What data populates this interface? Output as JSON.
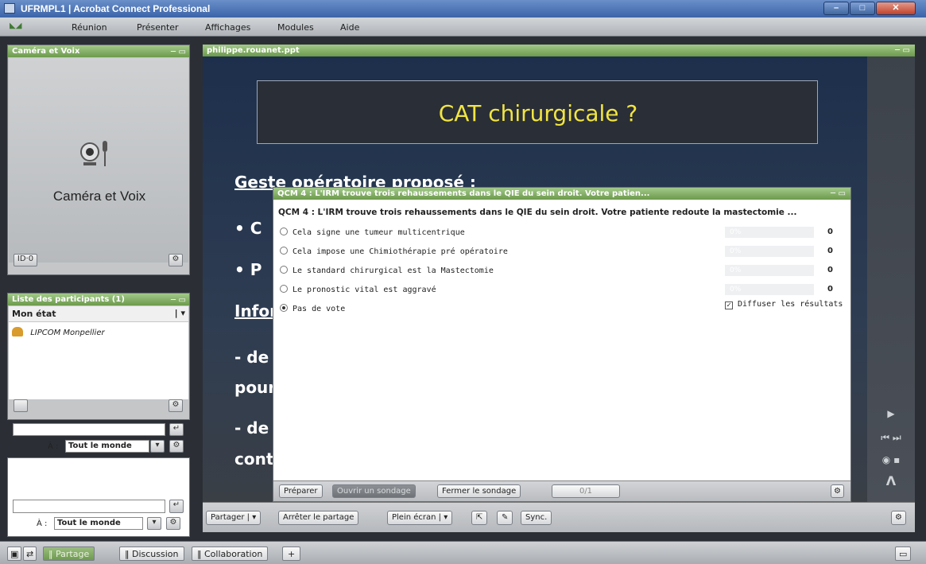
{
  "window": {
    "title": "UFRMPL1 | Acrobat Connect Professional"
  },
  "menu": {
    "items": [
      "Réunion",
      "Présenter",
      "Affichages",
      "Modules",
      "Aide"
    ]
  },
  "camera_pod": {
    "title": "Caméra et Voix",
    "label": "Caméra et Voix",
    "button_label": "ID·0"
  },
  "participants_pod": {
    "title": "Liste des participants (1)",
    "column_header": "Mon état",
    "items": [
      {
        "name": "LIPCOM Monpellier"
      }
    ]
  },
  "chat": {
    "recipient_label": "À :",
    "recipient_value": "Tout le monde"
  },
  "share_pod": {
    "title": "philippe.rouanet.ppt",
    "slide": {
      "title": "CAT chirurgicale ?",
      "lines": [
        "Geste opératoire proposé :",
        "•  C",
        "•  P",
        "Infor",
        "- de",
        "pour",
        "- de",
        "cont"
      ]
    },
    "toolbar": {
      "share": "Partager",
      "stop": "Arrêter le partage",
      "fullscreen": "Plein écran",
      "sync": "Sync."
    }
  },
  "poll": {
    "title": "QCM 4 : L'IRM trouve trois rehaussements dans le QIE du sein droit. Votre patien...",
    "question": "QCM 4 : L'IRM trouve trois rehaussements dans le QIE du sein droit. Votre patiente redoute la mastectomie ...",
    "options": [
      {
        "label": "Cela signe une tumeur multicentrique",
        "percent": "0%",
        "count": "0",
        "selected": false
      },
      {
        "label": "Cela impose une Chimiothérapie pré opératoire",
        "percent": "0%",
        "count": "0",
        "selected": false
      },
      {
        "label": "Le standard chirurgical est la Mastectomie",
        "percent": "0%",
        "count": "0",
        "selected": false
      },
      {
        "label": "Le pronostic vital est aggravé",
        "percent": "0%",
        "count": "0",
        "selected": false
      },
      {
        "label": "Pas de vote",
        "selected": true
      }
    ],
    "broadcast_label": "Diffuser les résultats",
    "buttons": {
      "prepare": "Préparer",
      "open": "Ouvrir un sondage",
      "close": "Fermer le sondage"
    },
    "progress": "0/1"
  },
  "bottom_tabs": {
    "share": "Partage",
    "discussion": "Discussion",
    "collaboration": "Collaboration",
    "add": "+"
  },
  "colors": {
    "pod_header": "#6c9a4c",
    "slide_title": "#f1e541",
    "slide_bg": "#1d2f4c"
  }
}
